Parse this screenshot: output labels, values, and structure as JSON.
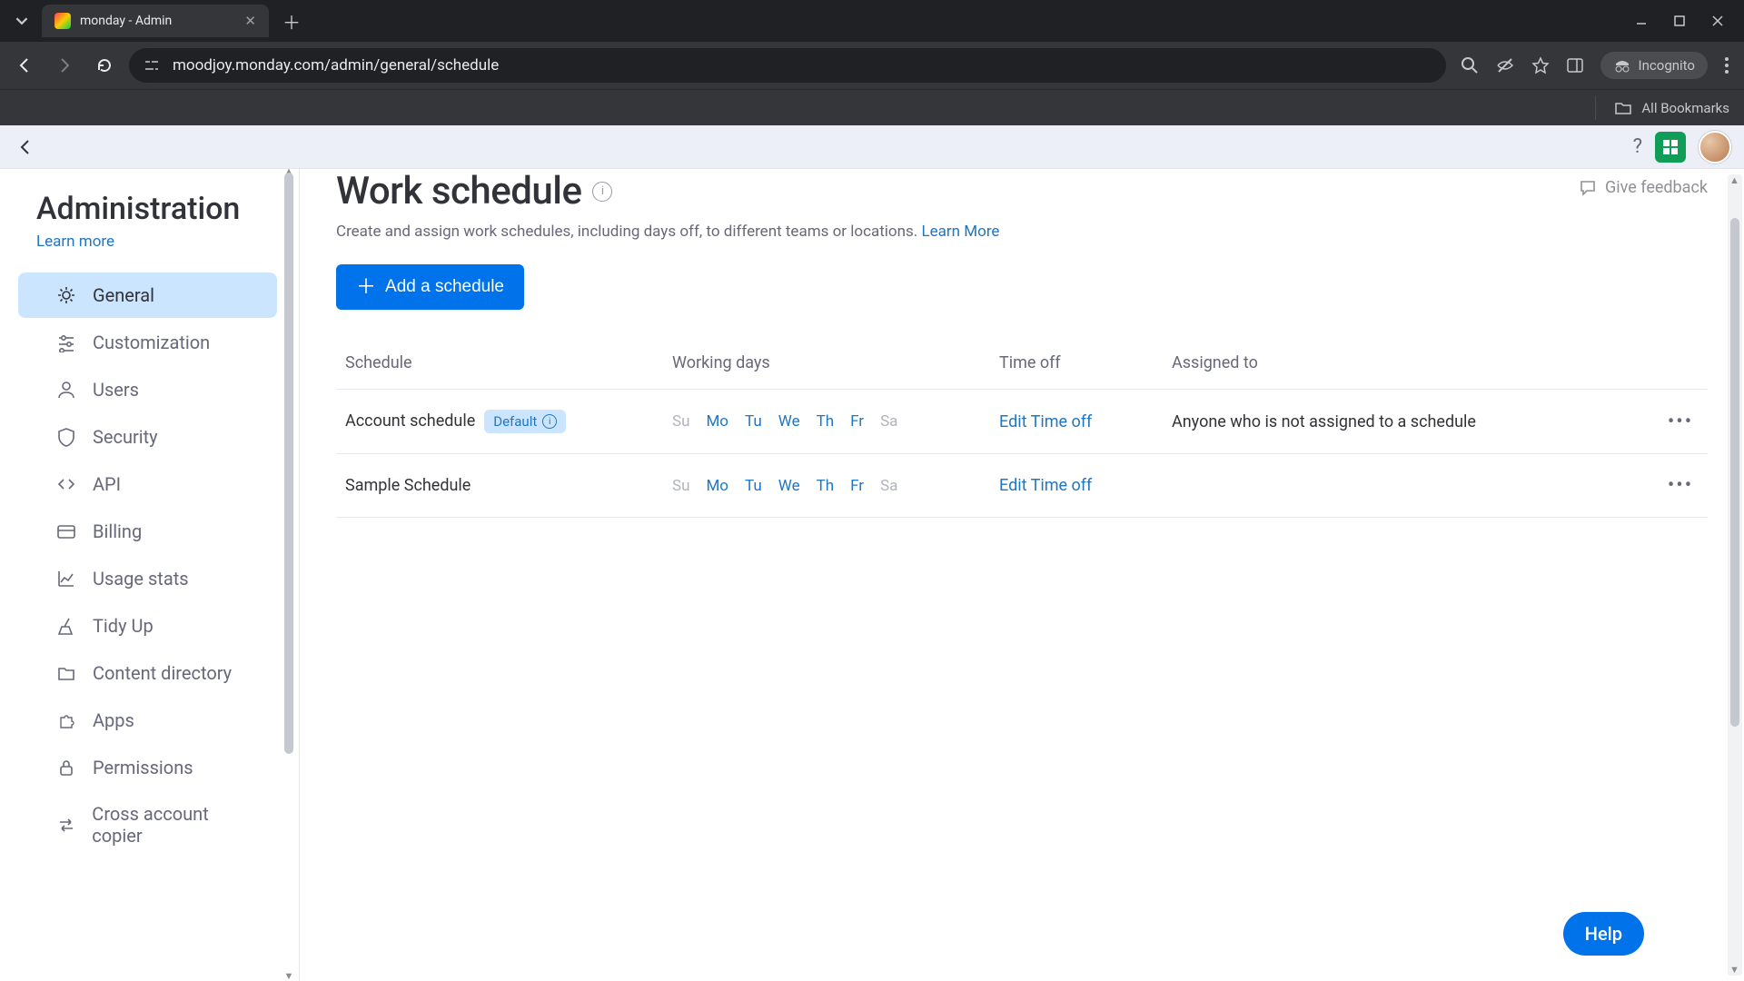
{
  "browser": {
    "tab_title": "monday - Admin",
    "url": "moodjoy.monday.com/admin/general/schedule",
    "incognito_label": "Incognito",
    "all_bookmarks": "All Bookmarks"
  },
  "topbar": {
    "help_tooltip": "?"
  },
  "sidebar": {
    "title": "Administration",
    "learn_more": "Learn more",
    "items": [
      {
        "label": "General",
        "icon": "gear-icon",
        "active": true
      },
      {
        "label": "Customization",
        "icon": "sliders-icon"
      },
      {
        "label": "Users",
        "icon": "user-icon"
      },
      {
        "label": "Security",
        "icon": "shield-icon"
      },
      {
        "label": "API",
        "icon": "code-icon"
      },
      {
        "label": "Billing",
        "icon": "card-icon"
      },
      {
        "label": "Usage stats",
        "icon": "chart-icon"
      },
      {
        "label": "Tidy Up",
        "icon": "broom-icon"
      },
      {
        "label": "Content directory",
        "icon": "folder-icon"
      },
      {
        "label": "Apps",
        "icon": "puzzle-icon"
      },
      {
        "label": "Permissions",
        "icon": "lock-icon"
      },
      {
        "label": "Cross account copier",
        "icon": "swap-icon"
      }
    ]
  },
  "page": {
    "title": "Work schedule",
    "description": "Create and assign work schedules, including days off, to different teams or locations. ",
    "learn_more": "Learn More",
    "give_feedback": "Give feedback",
    "add_button": "Add a schedule"
  },
  "table": {
    "headers": {
      "schedule": "Schedule",
      "working_days": "Working days",
      "time_off": "Time off",
      "assigned_to": "Assigned to"
    },
    "day_labels": [
      "Su",
      "Mo",
      "Tu",
      "We",
      "Th",
      "Fr",
      "Sa"
    ],
    "rows": [
      {
        "name": "Account schedule",
        "default_badge": "Default",
        "working": [
          false,
          true,
          true,
          true,
          true,
          true,
          false
        ],
        "time_off_link": "Edit Time off",
        "assigned": "Anyone who is not assigned to a schedule"
      },
      {
        "name": "Sample Schedule",
        "default_badge": null,
        "working": [
          false,
          true,
          true,
          true,
          true,
          true,
          false
        ],
        "time_off_link": "Edit Time off",
        "assigned": ""
      }
    ]
  },
  "help_button": "Help"
}
